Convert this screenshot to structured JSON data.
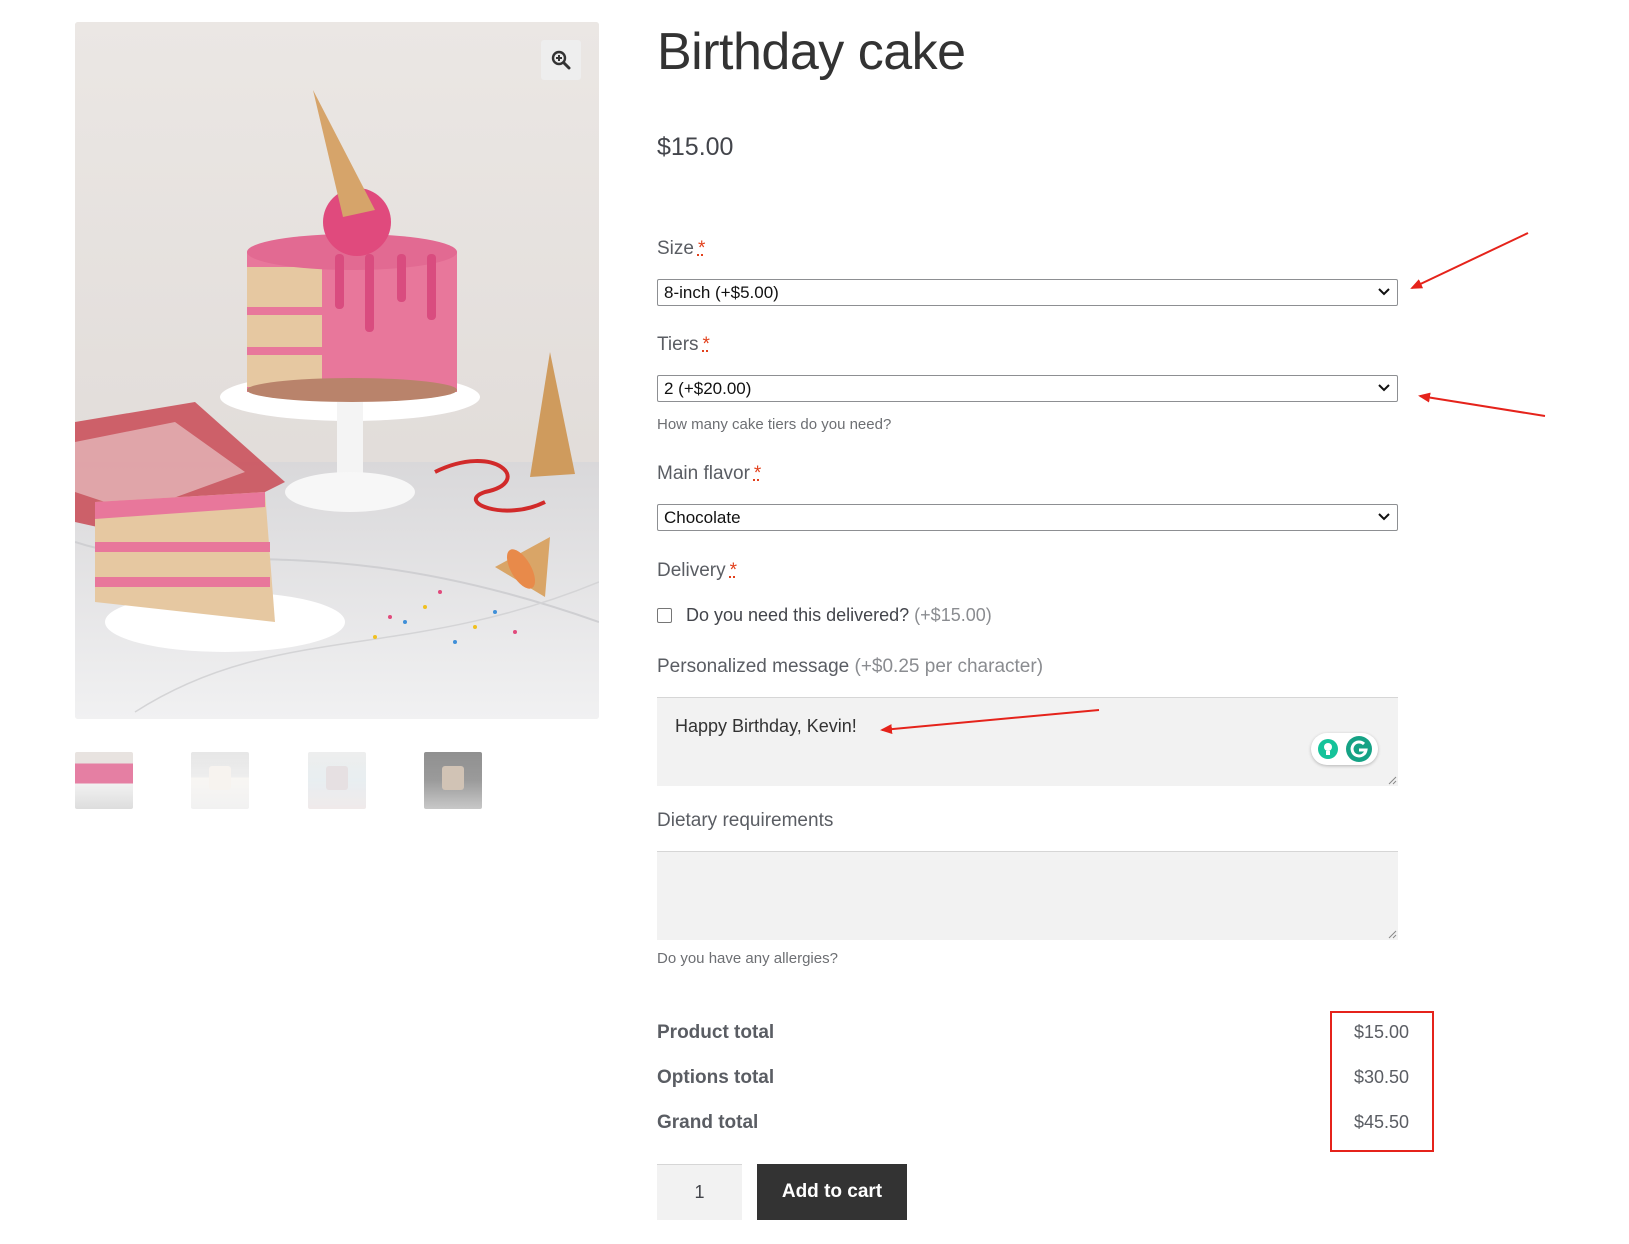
{
  "product": {
    "title": "Birthday cake",
    "price": "$15.00"
  },
  "gallery": {
    "zoom_icon": "magnifier-plus-icon",
    "thumbnails": [
      "thumb-1",
      "thumb-2",
      "thumb-3",
      "thumb-4"
    ]
  },
  "options": {
    "size": {
      "label": "Size",
      "required_mark": "*",
      "selected": "8-inch (+$5.00)"
    },
    "tiers": {
      "label": "Tiers",
      "required_mark": "*",
      "selected": "2 (+$20.00)",
      "help": "How many cake tiers do you need?"
    },
    "flavor": {
      "label": "Main flavor",
      "required_mark": "*",
      "selected": "Chocolate"
    },
    "delivery": {
      "label": "Delivery",
      "required_mark": "*",
      "checkbox_label": "Do you need this delivered?",
      "checkbox_price": "(+$15.00)",
      "checked": false
    },
    "message": {
      "label": "Personalized message",
      "price_note": "(+$0.25 per character)",
      "value": "Happy Birthday, Kevin!"
    },
    "dietary": {
      "label": "Dietary requirements",
      "value": "",
      "help": "Do you have any allergies?"
    }
  },
  "totals": {
    "product_label": "Product total",
    "product_value": "$15.00",
    "options_label": "Options total",
    "options_value": "$30.50",
    "grand_label": "Grand total",
    "grand_value": "$45.50"
  },
  "cart": {
    "quantity": "1",
    "add_label": "Add to cart"
  },
  "colors": {
    "accent_button": "#333333",
    "required": "#e2401c",
    "annotation": "#e5231b",
    "cake_pink": "#e8779b"
  }
}
